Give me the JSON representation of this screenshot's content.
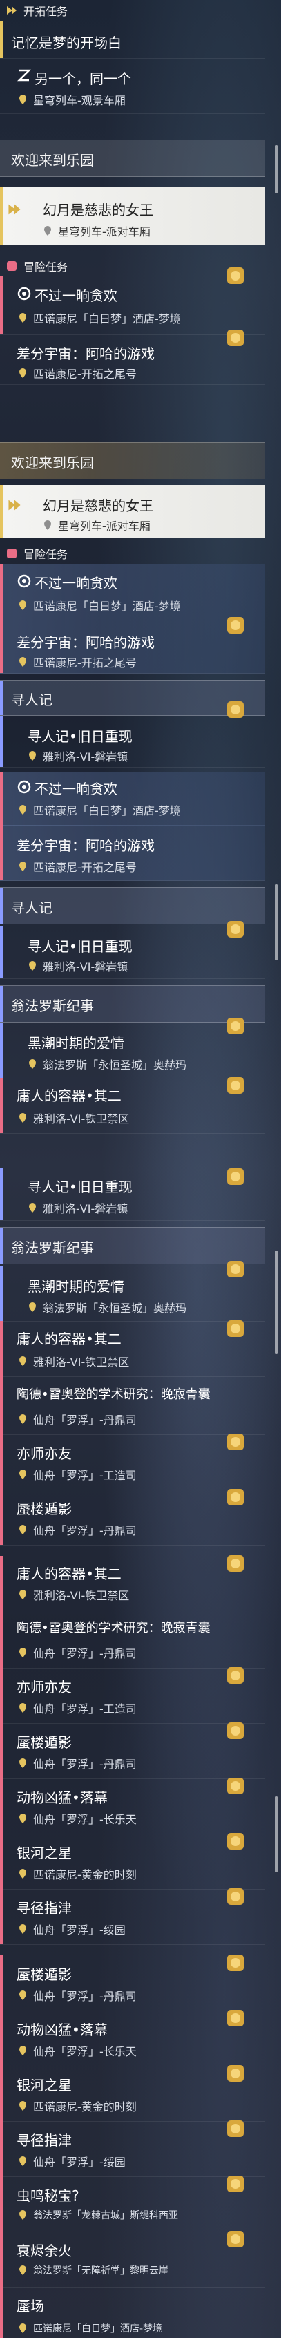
{
  "colors": {
    "trailblaze": "#e5c45f",
    "adventure": "#ea6d86",
    "companion": "#8a9bff",
    "badge": "#f0c150",
    "accent_purple": "#b6a0ff"
  },
  "icons": {
    "pin": "location-pin-icon",
    "badge": "quest-reward-badge-icon",
    "section": "quest-category-icon"
  },
  "sections": {
    "trailblaze": "开拓任务",
    "adventure": "冒险任务"
  },
  "quests": {
    "memory_dream": {
      "title": "记忆是梦的开场白"
    },
    "another_one": {
      "title": "另一个，同一个",
      "loc": "星穹列车-观景车厢"
    },
    "welcome": {
      "title": "欢迎来到乐园"
    },
    "phantasmal": {
      "title": "幻月是慈悲的女王",
      "loc": "星穹列车-派对车厢"
    },
    "no_rest": {
      "title": "不过一晌贪欢",
      "loc": "匹诺康尼「白日梦」酒店-梦境"
    },
    "diff": {
      "title": "差分宇宙：阿哈的游戏",
      "loc": "匹诺康尼-开拓之尾号"
    },
    "seeker": {
      "title": "寻人记"
    },
    "seeker_sub": {
      "title": "寻人记•旧日重现",
      "loc": "雅利洛-VI-磐岩镇"
    },
    "ompha": {
      "title": "翁法罗斯纪事"
    },
    "dark_tide": {
      "title": "黑潮时期的爱情",
      "loc": "翁法罗斯「永恒圣城」奥赫玛"
    },
    "tang": {
      "title": "庸人的容器•其二",
      "loc": "雅利洛-VI-铁卫禁区"
    },
    "taohuan": {
      "title": "陶德•雷奥登的学术研究：晚寂青囊",
      "loc": "仙舟「罗浮」-丹鼎司"
    },
    "teacher": {
      "title": "亦师亦友",
      "loc": "仙舟「罗浮」-工造司"
    },
    "tower": {
      "title": "蜃楼遁影",
      "loc": "仙舟「罗浮」-丹鼎司"
    },
    "beast": {
      "title": "动物凶猛•落幕",
      "loc": "仙舟「罗浮」-长乐天"
    },
    "galaxy": {
      "title": "银河之星",
      "loc": "匹诺康尼-黄金的时刻"
    },
    "guide": {
      "title": "寻径指津",
      "loc": "仙舟「罗浮」-绥园"
    },
    "bug": {
      "title": "虫鸣秘宝?",
      "loc": "翁法罗斯「龙棘古城」斯缇科西亚"
    },
    "remnant": {
      "title": "哀烬余火",
      "loc": "翁法罗斯「无障祈堂」黎明云崖"
    },
    "dream": {
      "title": "蜃场",
      "loc": "匹诺康尼「白日梦」酒店-梦境"
    }
  }
}
